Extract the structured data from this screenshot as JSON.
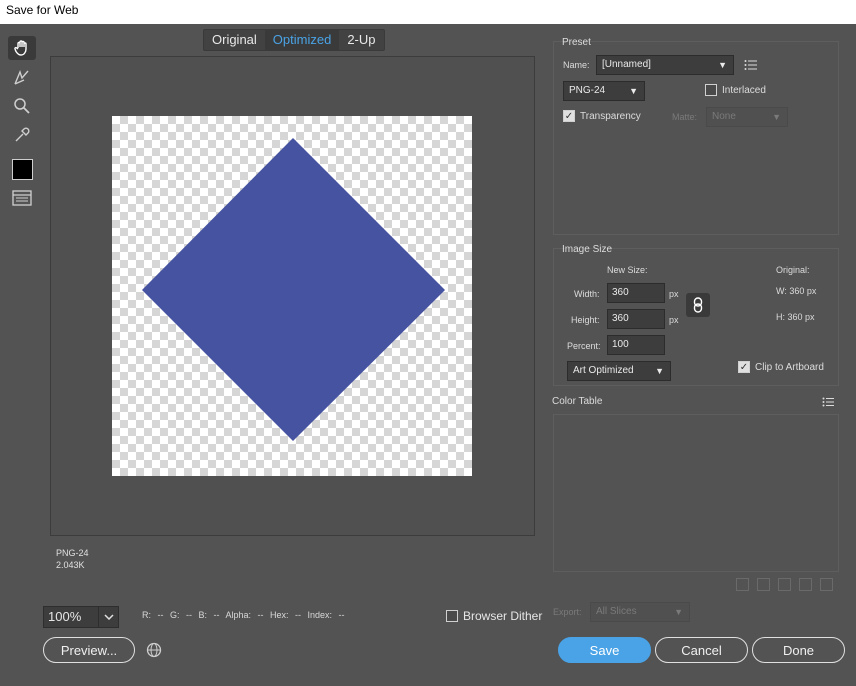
{
  "window": {
    "title": "Save for Web"
  },
  "toolbar": {
    "tools": [
      {
        "name": "hand-tool",
        "icon": "hand-icon"
      },
      {
        "name": "slice-select-tool",
        "icon": "slice-select-icon"
      },
      {
        "name": "zoom-tool",
        "icon": "magnifier-icon"
      },
      {
        "name": "eyedropper-tool",
        "icon": "eyedropper-icon"
      }
    ],
    "eyedropper_color": "#000000"
  },
  "view_tabs": {
    "original": "Original",
    "optimized": "Optimized",
    "two_up": "2-Up",
    "active": "Optimized"
  },
  "canvas": {
    "shape_color": "#4653A0",
    "format": "PNG-24",
    "file_size": "2.043K"
  },
  "status_bar": {
    "zoom": "100%",
    "readout": "R: --  G: --  B: --  Alpha: --  Hex: --  Index: --",
    "browser_dither_label": "Browser Dither",
    "browser_dither_checked": false
  },
  "preset": {
    "title": "Preset",
    "name_label": "Name:",
    "name_value": "[Unnamed]",
    "format_value": "PNG-24",
    "interlaced_label": "Interlaced",
    "interlaced_checked": false,
    "transparency_label": "Transparency",
    "transparency_checked": true,
    "matte_label": "Matte:",
    "matte_value": "None"
  },
  "image_size": {
    "title": "Image Size",
    "new_size_label": "New Size:",
    "width_label": "Width:",
    "width_value": "360",
    "height_label": "Height:",
    "height_value": "360",
    "percent_label": "Percent:",
    "percent_value": "100",
    "unit": "px",
    "original_label": "Original:",
    "orig_w": "W:   360 px",
    "orig_h": "H:   360 px",
    "resample_value": "Art Optimized",
    "clip_label": "Clip to Artboard",
    "clip_checked": true
  },
  "color_table": {
    "title": "Color Table"
  },
  "export": {
    "label": "Export:",
    "value": "All Slices"
  },
  "buttons": {
    "preview": "Preview...",
    "save": "Save",
    "cancel": "Cancel",
    "done": "Done"
  },
  "colors": {
    "accent": "#4aa3e6",
    "background": "#535353"
  }
}
